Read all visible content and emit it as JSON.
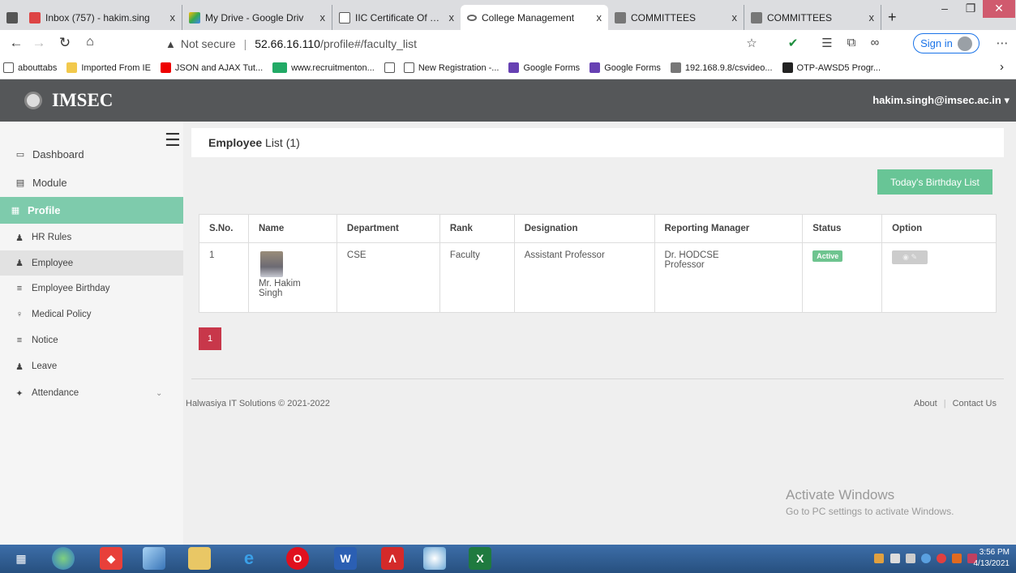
{
  "browser": {
    "tabs": [
      {
        "label": "",
        "close": ""
      },
      {
        "label": "Inbox (757) - hakim.sing",
        "close": "x"
      },
      {
        "label": "My Drive - Google Driv",
        "close": "x"
      },
      {
        "label": "IIC Certificate Of Establ",
        "close": "x"
      },
      {
        "label": "College Management",
        "close": "x"
      },
      {
        "label": "COMMITTEES",
        "close": "x"
      },
      {
        "label": "COMMITTEES",
        "close": "x"
      }
    ],
    "new_tab": "+",
    "address": {
      "security": "Not secure",
      "separator": "|",
      "host": "52.66.16.110",
      "path": "/profile#/faculty_list"
    },
    "sign_in": "Sign in",
    "bookmarks": [
      "abouttabs",
      "Imported From IE",
      "JSON and AJAX Tut...",
      "www.recruitmenton...",
      "",
      "New Registration -...",
      "Google Forms",
      "Google Forms",
      "192.168.9.8/csvideo...",
      "OTP-AWSD5 Progr..."
    ]
  },
  "app": {
    "logo": "IMSEC",
    "user": "hakim.singh@imsec.ac.in ▾"
  },
  "sidebar": {
    "items": [
      {
        "label": "Dashboard"
      },
      {
        "label": "Module"
      },
      {
        "label": "Profile"
      },
      {
        "label": "HR Rules"
      },
      {
        "label": "Employee"
      },
      {
        "label": "Employee Birthday"
      },
      {
        "label": "Medical Policy"
      },
      {
        "label": "Notice"
      },
      {
        "label": "Leave"
      },
      {
        "label": "Attendance"
      }
    ]
  },
  "main": {
    "title_bold": "Employee",
    "title_rest": " List (1)",
    "birthday_button": "Today's Birthday List",
    "table": {
      "headers": [
        "S.No.",
        "Name",
        "Department",
        "Rank",
        "Designation",
        "Reporting Manager",
        "Status",
        "Option"
      ],
      "rows": [
        {
          "sno": "1",
          "name": "Mr. Hakim Singh",
          "department": "CSE",
          "rank": "Faculty",
          "designation": "Assistant Professor",
          "manager_name": "Dr. HODCSE",
          "manager_title": "Professor",
          "status": "Active"
        }
      ]
    },
    "pagination": [
      "1"
    ],
    "footer": {
      "copyright": "Halwasiya IT Solutions © 2021-2022",
      "links": [
        "About",
        "Contact Us"
      ]
    },
    "watermark": {
      "line1": "Activate Windows",
      "line2": "Go to PC settings to activate Windows."
    }
  },
  "taskbar": {
    "time": "3:56 PM",
    "date": "4/13/2021"
  }
}
